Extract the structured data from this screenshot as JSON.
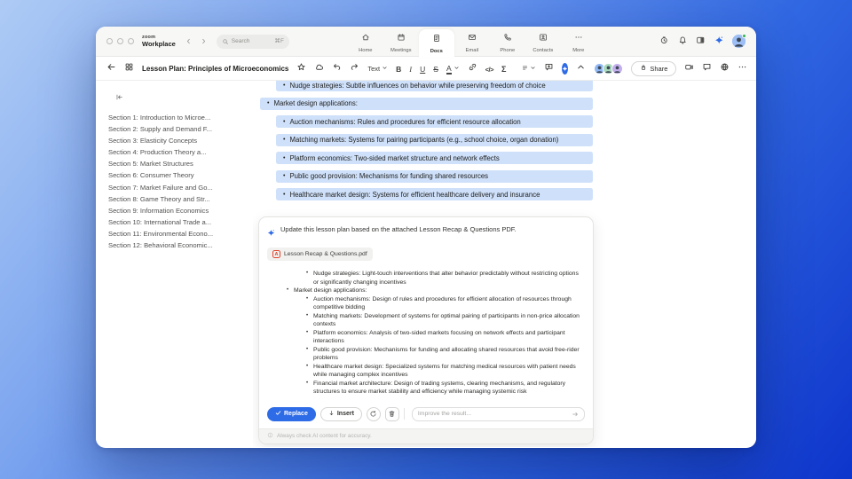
{
  "app": {
    "brand": {
      "top": "zoom",
      "bottom": "Workplace"
    },
    "search": {
      "placeholder": "Search",
      "shortcut": "⌘F"
    },
    "nav": [
      {
        "id": "home",
        "label": "Home",
        "icon": "home",
        "active": false
      },
      {
        "id": "meetings",
        "label": "Meetings",
        "icon": "calendar",
        "active": false
      },
      {
        "id": "docs",
        "label": "Docs",
        "icon": "doc",
        "active": true
      },
      {
        "id": "email",
        "label": "Email",
        "icon": "mail",
        "active": false
      },
      {
        "id": "phone",
        "label": "Phone",
        "icon": "phone",
        "active": false
      },
      {
        "id": "contacts",
        "label": "Contacts",
        "icon": "contacts",
        "active": false
      },
      {
        "id": "more",
        "label": "More",
        "icon": "dots",
        "active": false
      }
    ]
  },
  "toolbar": {
    "title": "Lesson Plan: Principles of Microeconomics",
    "text_style_label": "Text",
    "share_label": "Share",
    "collaborator_colors": [
      "#8fb8f5",
      "#a9d9bd",
      "#c3aeed"
    ]
  },
  "outline": {
    "items": [
      "Section 1: Introduction to Microe...",
      "Section 2: Supply and Demand F...",
      "Section 3: Elasticity Concepts",
      "Section 4: Production Theory a...",
      "Section 5: Market Structures",
      "Section 6: Consumer Theory",
      "Section 7: Market Failure and Go...",
      "Section 8: Game Theory and Str...",
      "Section 9: Information Economics",
      "Section 10: International Trade a...",
      "Section 11: Environmental Econo...",
      "Section 12: Behavioral Economic..."
    ]
  },
  "document": {
    "highlight_color": "#cfe1fa",
    "lines": [
      {
        "level": 2,
        "clipped": true,
        "text": "Nudge strategies: Subtle influences on behavior while preserving freedom of choice"
      },
      {
        "level": 1,
        "clipped": false,
        "text": "Market design applications:"
      },
      {
        "level": 2,
        "clipped": false,
        "text": "Auction mechanisms: Rules and procedures for efficient resource allocation"
      },
      {
        "level": 2,
        "clipped": false,
        "text": "Matching markets: Systems for pairing participants (e.g., school choice, organ donation)"
      },
      {
        "level": 2,
        "clipped": false,
        "text": "Platform economics: Two-sided market structure and network effects"
      },
      {
        "level": 2,
        "clipped": false,
        "text": "Public good provision: Mechanisms for funding shared resources"
      },
      {
        "level": 2,
        "clipped": false,
        "text": "Healthcare market design: Systems for efficient healthcare delivery and insurance"
      }
    ]
  },
  "ai_panel": {
    "prompt": "Update this lesson plan based on the attached Lesson Recap & Questions PDF.",
    "attachment_name": "Lesson Recap & Questions.pdf",
    "pdf_badge_letter": "A",
    "result": [
      {
        "level": 2,
        "text": "Nudge strategies: Light-touch interventions that alter behavior predictably without restricting options or significantly changing incentives"
      },
      {
        "level": 1,
        "text": "Market design applications:"
      },
      {
        "level": 2,
        "text": "Auction mechanisms: Design of rules and procedures for efficient allocation of resources through competitive bidding"
      },
      {
        "level": 2,
        "text": "Matching markets: Development of systems for optimal pairing of participants in non-price allocation contexts"
      },
      {
        "level": 2,
        "text": "Platform economics: Analysis of two-sided markets focusing on network effects and participant interactions"
      },
      {
        "level": 2,
        "text": "Public good provision: Mechanisms for funding and allocating shared resources that avoid free-rider problems"
      },
      {
        "level": 2,
        "text": "Healthcare market design: Specialized systems for matching medical resources with patient needs while managing complex incentives"
      },
      {
        "level": 2,
        "text": "Financial market architecture: Design of trading systems, clearing mechanisms, and regulatory structures to ensure market stability and efficiency while managing systemic risk"
      }
    ],
    "replace_label": "Replace",
    "insert_label": "Insert",
    "improve_placeholder": "Improve the result...",
    "disclaimer": "Always check AI content for accuracy."
  },
  "colors": {
    "accent": "#2e6be6",
    "highlight": "#cfe1fa",
    "pdf_red": "#e0452e"
  }
}
